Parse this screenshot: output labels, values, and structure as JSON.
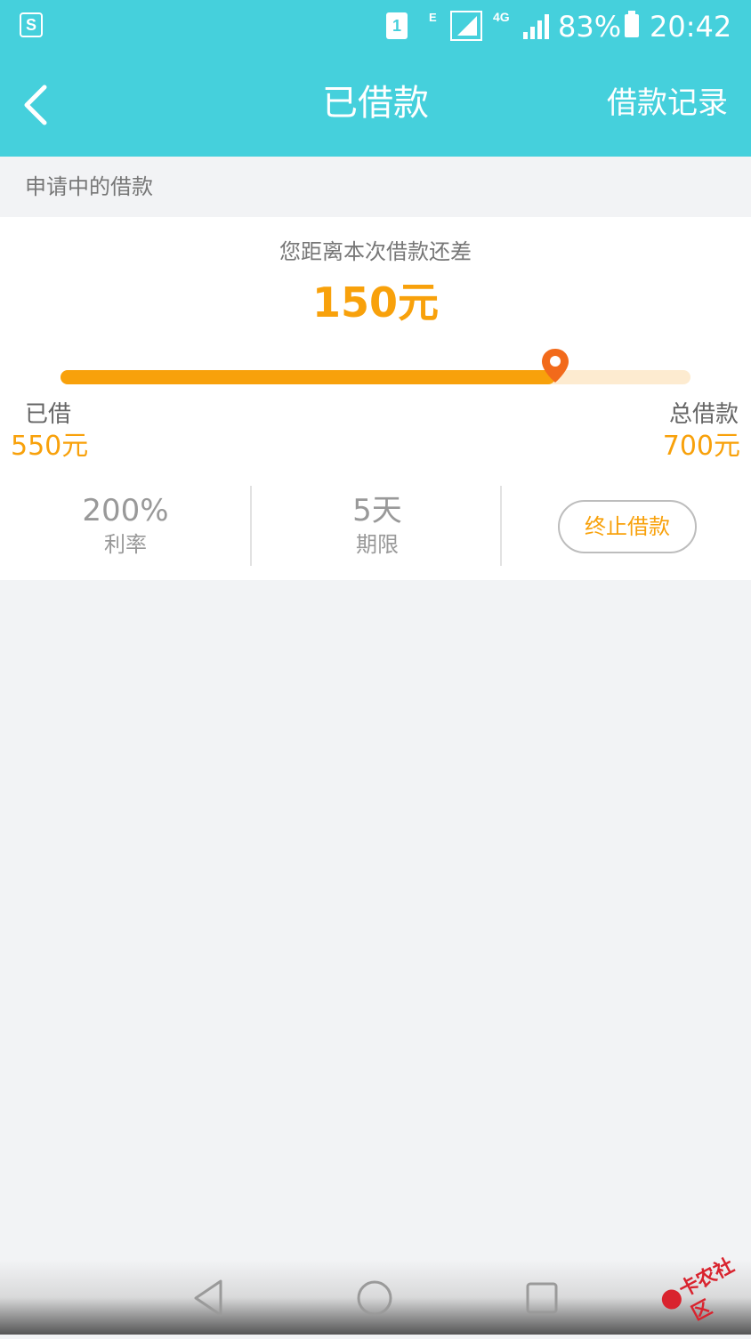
{
  "status_bar": {
    "app_badge": "S",
    "sim_slot": "1",
    "network_1": "E",
    "network_2": "4G",
    "battery": "83%",
    "time": "20:42"
  },
  "header": {
    "back_icon": "chevron-left-icon",
    "title": "已借款",
    "record_link": "借款记录",
    "background_color": "#45d0dc"
  },
  "section": {
    "title": "申请中的借款"
  },
  "loan": {
    "remaining_label": "您距离本次借款还差",
    "remaining_amount": "150元",
    "progress_fraction": 0.786,
    "borrowed_label": "已借",
    "borrowed_amount": "550元",
    "total_label": "总借款",
    "total_amount": "700元",
    "accent_color": "#f8a10b"
  },
  "stats": {
    "rate_value": "200%",
    "rate_label": "利率",
    "term_value": "5天",
    "term_label": "期限",
    "stop_button": "终止借款"
  },
  "watermark": {
    "text": "卡农社区"
  }
}
